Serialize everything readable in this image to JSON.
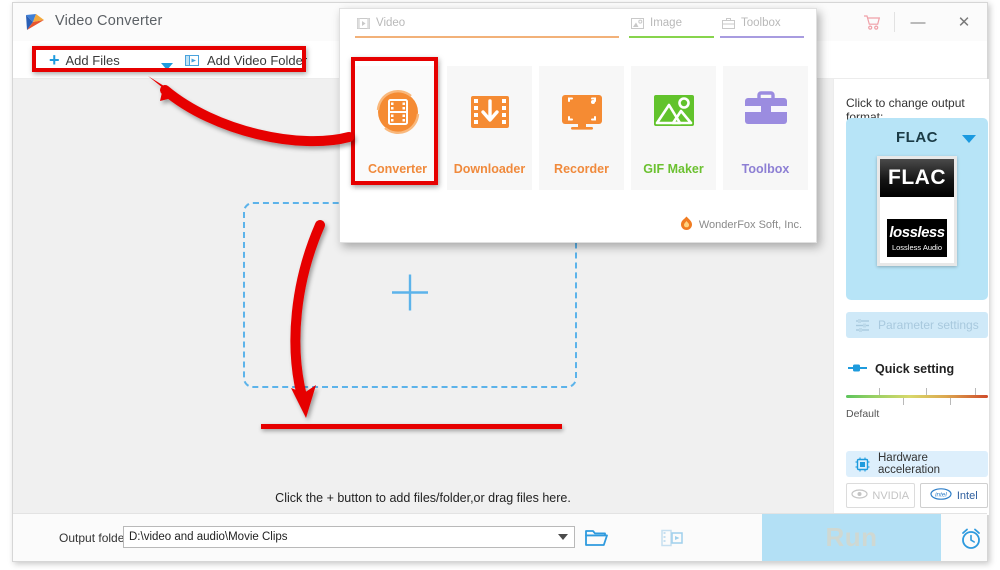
{
  "window": {
    "title": "Video Converter",
    "logo_icon": "wonderfox-play-logo-icon",
    "controls": {
      "cart_icon": "shopping-cart-icon",
      "minimize_label": "—",
      "close_label": "✕"
    }
  },
  "toolbar": {
    "add_files_label": "Add Files",
    "add_files_plus": "+",
    "add_files_caret_icon": "chevron-down-icon",
    "add_video_folder_label": "Add Video Folder",
    "add_video_folder_icon": "video-folder-icon"
  },
  "main": {
    "dropzone_plus_icon": "plus-icon",
    "hint_text": "Click the + button to add files/folder,or drag files here."
  },
  "sidebar": {
    "change_format_label": "Click to change output format:",
    "format": {
      "name": "FLAC",
      "caret_icon": "chevron-down-icon",
      "thumb_title": "FLAC",
      "thumb_badge": "lossless",
      "thumb_sub": "Lossless Audio"
    },
    "parameter_settings_label": "Parameter settings",
    "parameter_settings_icon": "sliders-icon",
    "quick_setting_label": "Quick setting",
    "quick_setting_icon": "slider-handle-icon",
    "quality_default_label": "Default",
    "hardware_acceleration_label": "Hardware acceleration",
    "hardware_acceleration_icon": "cpu-chip-icon",
    "gpu_options": [
      {
        "label": "NVIDIA",
        "icon": "nvidia-eye-icon",
        "enabled": false
      },
      {
        "label": "Intel",
        "icon": "intel-logo-icon",
        "enabled": true
      }
    ]
  },
  "bottom": {
    "output_folder_label": "Output folder:",
    "output_folder_value": "D:\\video and audio\\Movie Clips",
    "output_folder_caret_icon": "chevron-down-icon",
    "open_folder_icon": "open-folder-icon",
    "merge_icon": "merge-video-icon",
    "run_label": "Run",
    "alarm_icon": "alarm-clock-icon"
  },
  "popup": {
    "tabs": [
      {
        "label": "Video",
        "icon": "video-clip-icon",
        "color": "#f2b179"
      },
      {
        "label": "Image",
        "icon": "image-icon",
        "color": "#87d44c"
      },
      {
        "label": "Toolbox",
        "icon": "toolbox-icon",
        "color": "#a89ce0"
      }
    ],
    "tiles": [
      {
        "label": "Converter",
        "icon": "converter-icon",
        "color": "#f08a3c",
        "selected": true
      },
      {
        "label": "Downloader",
        "icon": "downloader-icon",
        "color": "#f08a3c",
        "selected": false
      },
      {
        "label": "Recorder",
        "icon": "recorder-icon",
        "color": "#f08a3c",
        "selected": false
      },
      {
        "label": "GIF Maker",
        "icon": "gif-maker-icon",
        "color": "#6cc131",
        "selected": false
      },
      {
        "label": "Toolbox",
        "icon": "toolbox-case-icon",
        "color": "#8d7fd4",
        "selected": false
      }
    ],
    "brand_text": "WonderFox Soft, Inc.",
    "brand_icon": "wonderfox-flame-icon"
  },
  "annotations": {
    "highlight_color": "#e60000",
    "boxes": [
      "add-files-toolbar",
      "converter-tile"
    ],
    "arrows": [
      "converter-to-add-files",
      "popup-to-hint-text"
    ],
    "underline": "hint-text-underline"
  }
}
